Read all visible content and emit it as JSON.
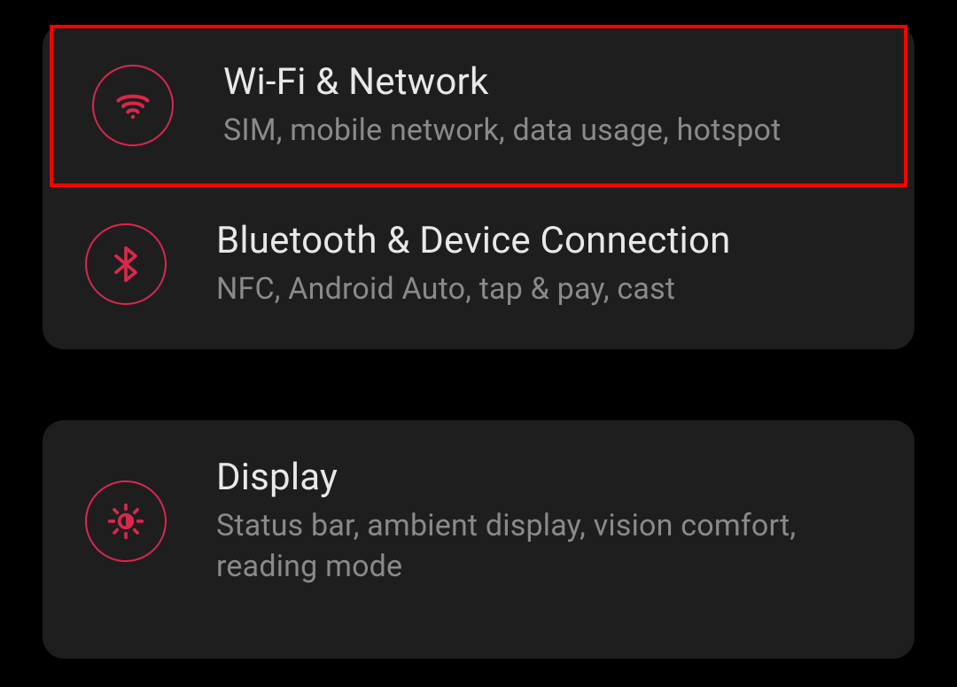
{
  "groups": [
    {
      "items": [
        {
          "title": "Wi-Fi & Network",
          "subtitle": "SIM, mobile network, data usage, hotspot",
          "icon": "wifi-icon",
          "highlighted": true
        },
        {
          "title": "Bluetooth & Device Connection",
          "subtitle": "NFC, Android Auto, tap & pay, cast",
          "icon": "bluetooth-icon",
          "highlighted": false
        }
      ]
    },
    {
      "items": [
        {
          "title": "Display",
          "subtitle": "Status bar, ambient display, vision comfort, reading mode",
          "icon": "brightness-icon",
          "highlighted": false
        }
      ]
    }
  ],
  "colors": {
    "accent": "#d9294b",
    "highlight_border": "#ff0000",
    "card_bg": "#1e1e1e",
    "page_bg": "#000000",
    "title_text": "#e8e8e8",
    "subtitle_text": "#8a8a8a"
  }
}
